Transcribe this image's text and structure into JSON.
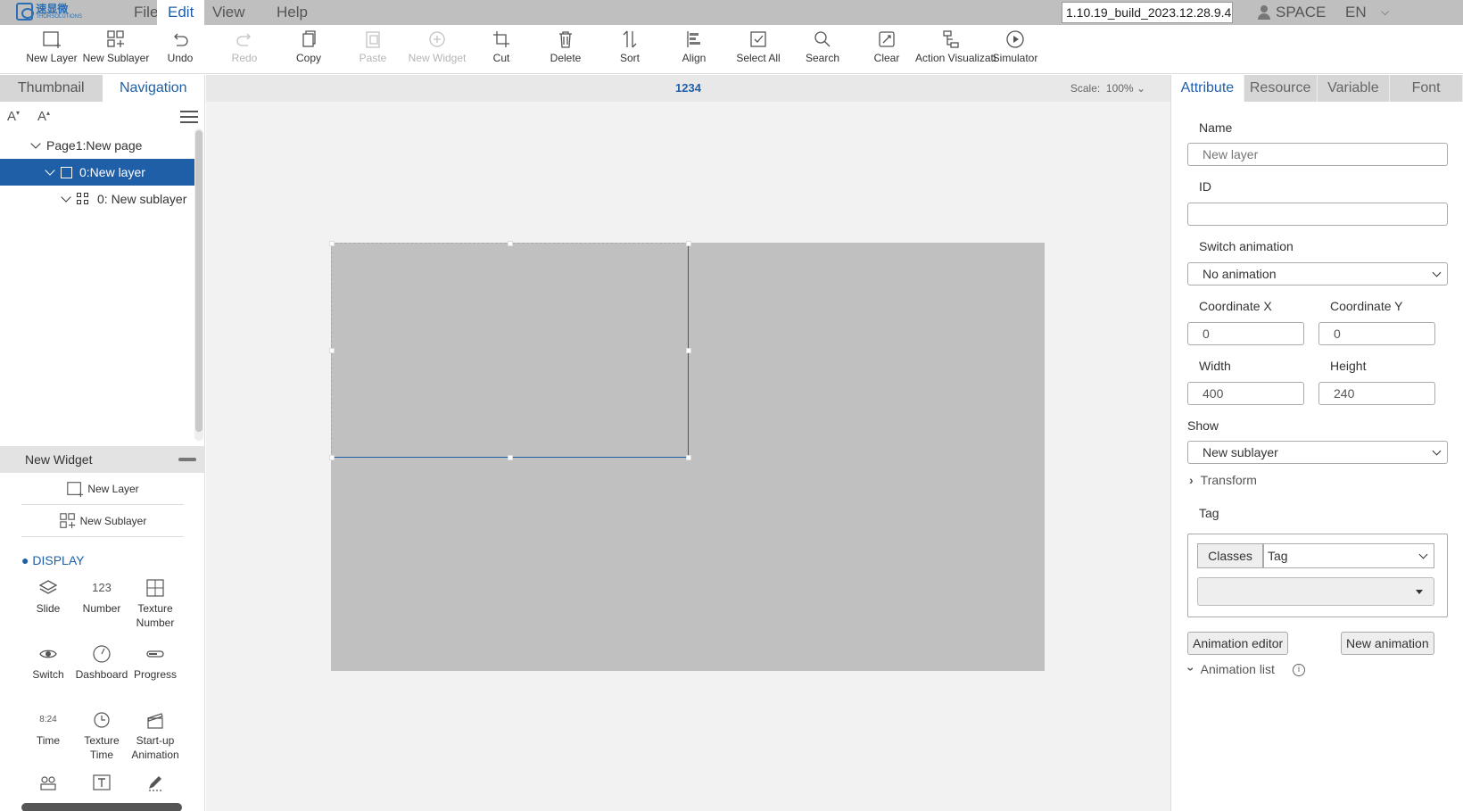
{
  "app": {
    "logo_cn": "速显微",
    "logo_en": "THORSOLUTIONS",
    "version": "1.10.19_build_2023.12.28.9.4",
    "user": "SPACE",
    "language": "EN"
  },
  "menu": [
    {
      "label": "File"
    },
    {
      "label": "Edit"
    },
    {
      "label": "View"
    },
    {
      "label": "Help"
    }
  ],
  "toolbar": [
    {
      "label": "New Layer",
      "icon": "new-layer-icon",
      "enabled": true
    },
    {
      "label": "New Sublayer",
      "icon": "new-sublayer-icon",
      "enabled": true
    },
    {
      "label": "Undo",
      "icon": "undo-icon",
      "enabled": true
    },
    {
      "label": "Redo",
      "icon": "redo-icon",
      "enabled": false
    },
    {
      "label": "Copy",
      "icon": "copy-icon",
      "enabled": true
    },
    {
      "label": "Paste",
      "icon": "paste-icon",
      "enabled": false
    },
    {
      "label": "New Widget",
      "icon": "new-widget-icon",
      "enabled": false
    },
    {
      "label": "Cut",
      "icon": "crop-icon",
      "enabled": true
    },
    {
      "label": "Delete",
      "icon": "trash-icon",
      "enabled": true
    },
    {
      "label": "Sort",
      "icon": "sort-icon",
      "enabled": true
    },
    {
      "label": "Align",
      "icon": "align-icon",
      "enabled": true
    },
    {
      "label": "Select All",
      "icon": "select-all-icon",
      "enabled": true
    },
    {
      "label": "Search",
      "icon": "search-icon",
      "enabled": true
    },
    {
      "label": "Clear",
      "icon": "clear-icon",
      "enabled": true
    },
    {
      "label": "Action Visualizati",
      "icon": "action-visualization-icon",
      "enabled": true
    },
    {
      "label": "Simulator",
      "icon": "play-icon",
      "enabled": true
    }
  ],
  "left_panel": {
    "tabs": [
      {
        "label": "Thumbnail"
      },
      {
        "label": "Navigation"
      }
    ],
    "font_smaller": "A",
    "font_larger": "A",
    "tree": [
      {
        "label": "Page1:New page"
      },
      {
        "label": "0:New layer"
      },
      {
        "label": "0: New sublayer"
      }
    ],
    "new_widget": {
      "title": "New Widget",
      "new_layer": "New Layer",
      "new_sublayer": "New Sublayer",
      "section": "DISPLAY",
      "widgets": [
        {
          "label": "Slide",
          "icon": "layers-icon"
        },
        {
          "label": "Number",
          "icon": "number-icon",
          "glyph": "123"
        },
        {
          "label": "Texture Number",
          "icon": "texture-number-icon"
        },
        {
          "label": "Switch",
          "icon": "eye-icon"
        },
        {
          "label": "Dashboard",
          "icon": "dashboard-icon"
        },
        {
          "label": "Progress",
          "icon": "progress-icon"
        },
        {
          "label": "Time",
          "icon": "time-icon",
          "glyph": "8:24"
        },
        {
          "label": "Texture Time",
          "icon": "clock-icon"
        },
        {
          "label": "Start-up Animation",
          "icon": "clapper-icon"
        }
      ]
    }
  },
  "canvas": {
    "page_name": "1234",
    "scale_label": "Scale:",
    "scale_value": "100%"
  },
  "right_panel": {
    "tabs": [
      {
        "label": "Attribute"
      },
      {
        "label": "Resource"
      },
      {
        "label": "Variable"
      },
      {
        "label": "Font"
      }
    ],
    "name_label": "Name",
    "name_placeholder": "New layer",
    "id_label": "ID",
    "id_value": "",
    "switch_animation_label": "Switch animation",
    "switch_animation_value": "No animation",
    "coord_x_label": "Coordinate X",
    "coord_x_value": "0",
    "coord_y_label": "Coordinate Y",
    "coord_y_value": "0",
    "width_label": "Width",
    "width_value": "400",
    "height_label": "Height",
    "height_value": "240",
    "show_label": "Show",
    "show_value": "New sublayer",
    "transform_label": "Transform",
    "tag_label": "Tag",
    "classes_button": "Classes",
    "tag_select_value": "Tag",
    "animation_editor_button": "Animation editor",
    "new_animation_button": "New animation",
    "animation_list_label": "Animation list"
  },
  "colors": {
    "accent": "#1f5fa8",
    "menubar_bg": "#bfbfbf",
    "stage_bg": "#c0c0c0"
  }
}
